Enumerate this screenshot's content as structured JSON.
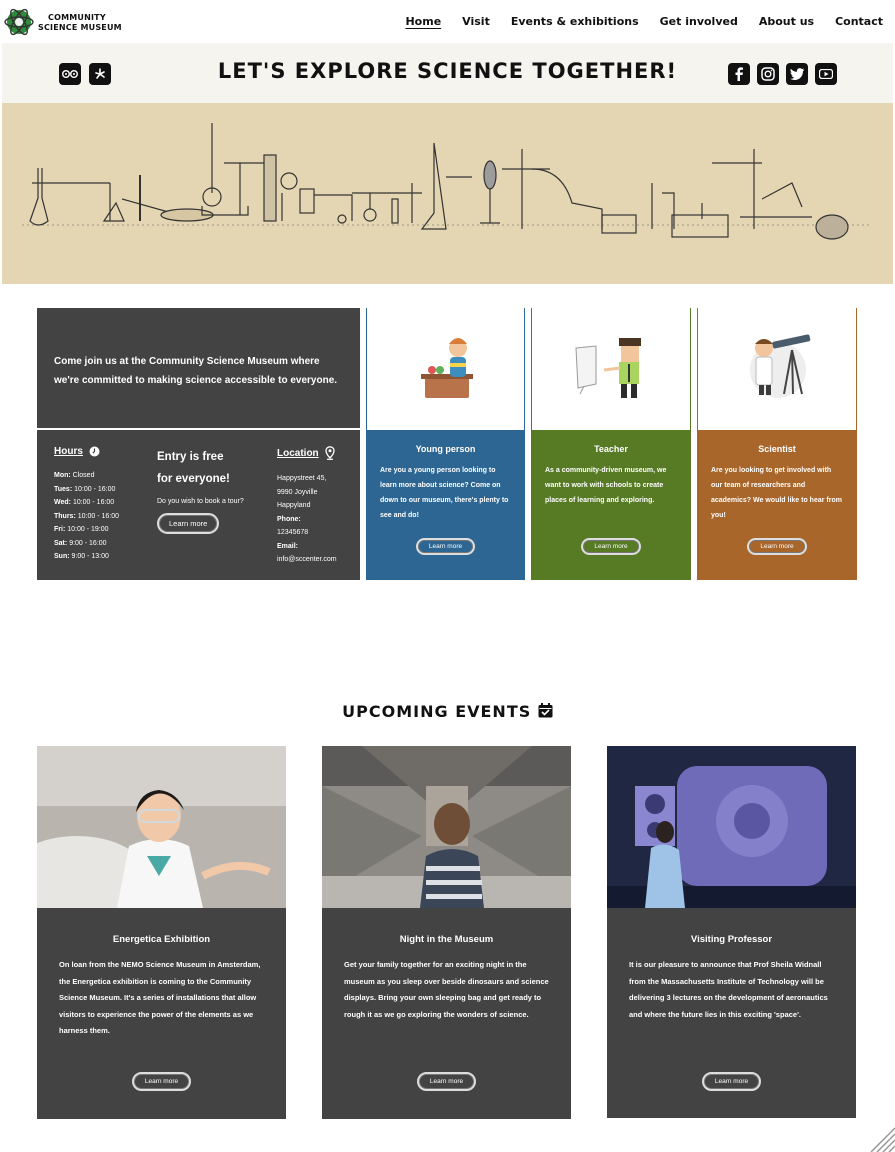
{
  "site": {
    "logo_text_line1": "COMMUNITY",
    "logo_text_line2": "SCIENCE MUSEUM"
  },
  "nav": {
    "items": [
      {
        "label": "Home",
        "active": true
      },
      {
        "label": "Visit",
        "active": false
      },
      {
        "label": "Events & exhibitions",
        "active": false
      },
      {
        "label": "Get involved",
        "active": false
      },
      {
        "label": "About us",
        "active": false
      },
      {
        "label": "Contact",
        "active": false
      }
    ]
  },
  "tagline": "LET'S EXPLORE SCIENCE TOGETHER!",
  "social_left": [
    "tripadvisor-icon",
    "yelp-icon"
  ],
  "social_right": [
    "facebook-icon",
    "instagram-icon",
    "twitter-icon",
    "youtube-icon"
  ],
  "intro": "Come join us at the Community Science Museum where we're committed to making science accessible to everyone.",
  "hours": {
    "title": "Hours",
    "rows": [
      {
        "day": "Mon:",
        "time": "Closed"
      },
      {
        "day": "Tues:",
        "time": "10:00 - 16:00"
      },
      {
        "day": "Wed:",
        "time": "10:00 - 16:00"
      },
      {
        "day": "Thurs:",
        "time": "10:00 - 16:00"
      },
      {
        "day": "Fri:",
        "time": "10:00 - 19:00"
      },
      {
        "day": "Sat:",
        "time": "9:00 - 16:00"
      },
      {
        "day": "Sun:",
        "time": "9:00 - 13:00"
      }
    ]
  },
  "entry": {
    "title_line1": "Entry is free",
    "title_line2": "for everyone!",
    "text": "Do you wish to book a tour?",
    "button": "Learn more"
  },
  "location": {
    "title": "Location",
    "address1": "Happystreet 45,",
    "address2": "9990 Joyville",
    "address3": "Happyland",
    "phone_label": "Phone:",
    "phone": "12345678",
    "email_label": "Email:",
    "email": "info@sccenter.com"
  },
  "audience": [
    {
      "title": "Young person",
      "text": "Are you a young person looking to learn more about science? Come on down to our museum, there's plenty to see and do!",
      "button": "Learn more",
      "color": "#2d6692"
    },
    {
      "title": "Teacher",
      "text": "As a community-driven museum, we want to work with schools to create places of learning and exploring.",
      "button": "Learn more",
      "color": "#577a24"
    },
    {
      "title": "Scientist",
      "text": "Are you looking to get involved with our team of researchers and academics? We would like to hear from you!",
      "button": "Learn more",
      "color": "#a8662b"
    }
  ],
  "events": {
    "title": "UPCOMING EVENTS",
    "items": [
      {
        "title": "Energetica Exhibition",
        "text": "On loan from the NEMO Science Museum in Amsterdam, the Energetica exhibition is coming to the Community Science Museum. It's a series of installations that allow visitors to experience the power of the elements as we harness them.",
        "button": "Learn more"
      },
      {
        "title": "Night in the Museum",
        "text": "Get your family together for an exciting night in the museum as you sleep over beside dinosaurs and science displays. Bring your own sleeping bag and get ready to rough it as we go exploring the wonders of science.",
        "button": "Learn more"
      },
      {
        "title": "Visiting Professor",
        "text": "It is our pleasure to announce that Prof Sheila Widnall from the Massachusetts Institute of Technology will be delivering 3 lectures on the development of aeronautics and where the future lies in this exciting 'space'.",
        "button": "Learn more"
      }
    ]
  },
  "colors": {
    "dark_panel": "#434343",
    "hero_bg": "#e5d6b3",
    "tagbar_bg": "#f6f4ee"
  }
}
